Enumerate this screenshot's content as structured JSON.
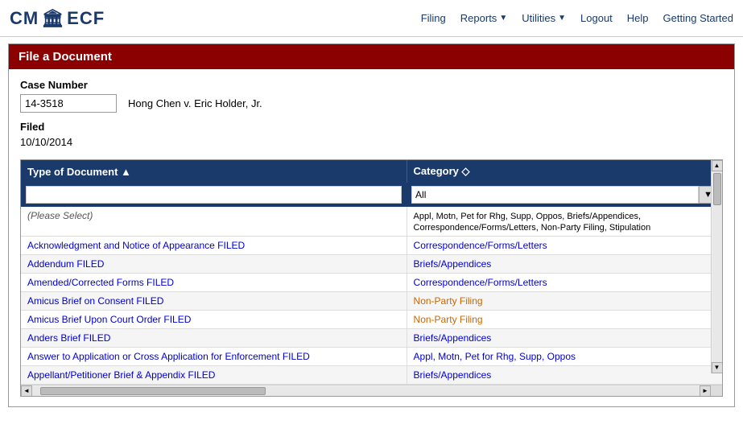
{
  "header": {
    "logo_text": "CM/ECF",
    "logo_icon": "🏛",
    "nav_items": [
      {
        "label": "Filing",
        "has_dropdown": false
      },
      {
        "label": "Reports",
        "has_dropdown": true
      },
      {
        "label": "Utilities",
        "has_dropdown": true
      },
      {
        "label": "Logout",
        "has_dropdown": false
      },
      {
        "label": "Help",
        "has_dropdown": false
      },
      {
        "label": "Getting Started",
        "has_dropdown": false
      }
    ]
  },
  "panel": {
    "title": "File a Document",
    "case_number_label": "Case Number",
    "case_number_value": "14-3518",
    "case_title": "Hong Chen v. Eric Holder, Jr.",
    "filed_label": "Filed",
    "filed_date": "10/10/2014"
  },
  "table": {
    "col1_header": "Type of Document ▲",
    "col2_header": "Category ◇",
    "filter_placeholder": "",
    "category_default": "All",
    "category_options": [
      "All",
      "Appl, Motn, Pet for Rhg, Supp, Oppos",
      "Briefs/Appendices",
      "Correspondence/Forms/Letters",
      "Non-Party Filing",
      "Stipulation"
    ],
    "rows": [
      {
        "doc_type": "(Please Select)",
        "category": "Appl, Motn, Pet for Rhg, Supp, Oppos, Briefs/Appendices, Correspondence/Forms/Letters, Non-Party Filing, Stipulation",
        "doc_color": "plain",
        "cat_color": "plain"
      },
      {
        "doc_type": "Acknowledgment and Notice of Appearance FILED",
        "category": "Correspondence/Forms/Letters",
        "doc_color": "blue",
        "cat_color": "blue"
      },
      {
        "doc_type": "Addendum FILED",
        "category": "Briefs/Appendices",
        "doc_color": "blue",
        "cat_color": "blue"
      },
      {
        "doc_type": "Amended/Corrected Forms FILED",
        "category": "Correspondence/Forms/Letters",
        "doc_color": "blue",
        "cat_color": "blue"
      },
      {
        "doc_type": "Amicus Brief on Consent FILED",
        "category": "Non-Party Filing",
        "doc_color": "blue",
        "cat_color": "orange"
      },
      {
        "doc_type": "Amicus Brief Upon Court Order FILED",
        "category": "Non-Party Filing",
        "doc_color": "blue",
        "cat_color": "orange"
      },
      {
        "doc_type": "Anders Brief FILED",
        "category": "Briefs/Appendices",
        "doc_color": "blue",
        "cat_color": "blue"
      },
      {
        "doc_type": "Answer to Application or Cross Application for Enforcement FILED",
        "category": "Appl, Motn, Pet for Rhg, Supp, Oppos",
        "doc_color": "blue",
        "cat_color": "blue"
      },
      {
        "doc_type": "Appellant/Petitioner Brief & Appendix FILED",
        "category": "Briefs/Appendices",
        "doc_color": "blue",
        "cat_color": "blue"
      }
    ]
  }
}
